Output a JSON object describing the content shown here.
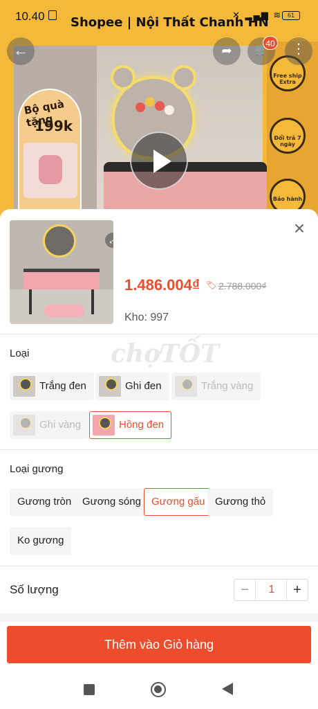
{
  "status_bar": {
    "time": "10.40",
    "icons": "✕ ▂▄▆ ≋",
    "battery": "61"
  },
  "header": {
    "shop_title": "Shopee | Nội Thất Chanh HN",
    "cart_count": "40"
  },
  "banner": {
    "gift_text": "Bộ quà tặng",
    "gift_price": "199k",
    "badges": [
      {
        "label": "Free ship Extra"
      },
      {
        "label": "Đổi trả 7 ngày"
      },
      {
        "label": "Bảo hành"
      }
    ]
  },
  "product": {
    "price": "1.486.004₫",
    "old_price": "2.788.000₫",
    "stock": "Kho: 997"
  },
  "watermark": "chợTỐT",
  "variants": {
    "label": "Loại",
    "options": [
      {
        "label": "Trắng đen",
        "state": "normal"
      },
      {
        "label": "Ghi đen",
        "state": "normal"
      },
      {
        "label": "Trắng vàng",
        "state": "disabled"
      },
      {
        "label": "Ghi vàng",
        "state": "disabled"
      },
      {
        "label": "Hồng đen",
        "state": "selected"
      }
    ]
  },
  "mirror_type": {
    "label": "Loại gương",
    "options": [
      {
        "label": "Gương tròn",
        "state": "normal"
      },
      {
        "label": "Gương sóng",
        "state": "normal"
      },
      {
        "label": "Gương gấu",
        "state": "selected"
      },
      {
        "label": "Gương thỏ",
        "state": "normal"
      },
      {
        "label": "Ko gương",
        "state": "normal"
      }
    ]
  },
  "quantity": {
    "label": "Số lượng",
    "value": "1",
    "minus": "−",
    "plus": "+"
  },
  "add_to_cart_label": "Thêm vào Giỏ hàng",
  "colors": {
    "accent": "#ee4d2d",
    "banner": "#f4b93a"
  }
}
